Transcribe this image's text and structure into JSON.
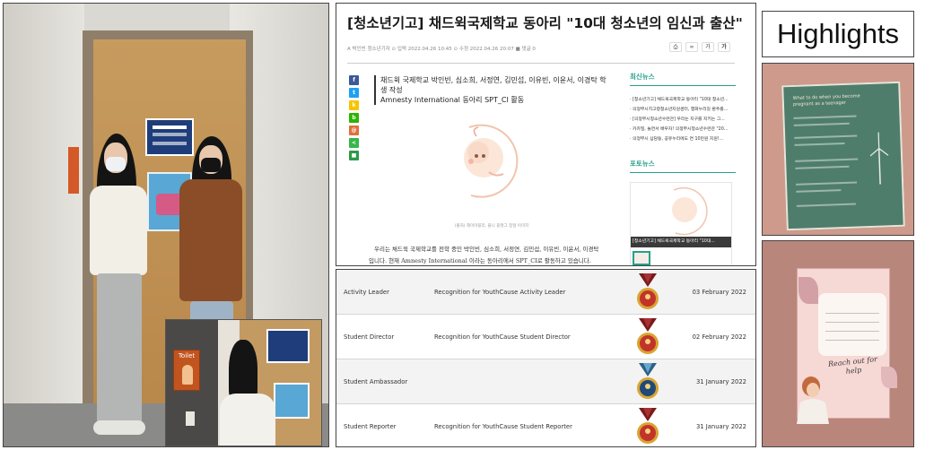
{
  "article": {
    "title": "[청소년기고] 채드윅국제학교 동아리 \"10대 청소년의 임신과 출산\"",
    "meta": "A 박인빈 청소년기자   ⊙ 입력 2022.04.26 10:45   ⊙ 수정 2022.04.26 20:07   ■ 댓글 0",
    "tools": [
      "⎙",
      "∞",
      "가",
      "가"
    ],
    "summary_line1": "채드윅 국제학교 박인빈, 심소희, 서정연, 김민섭, 이유빈, 이윤서, 이경탁 학생 작성",
    "summary_line2": "Amnesty International 동아리 SPT_CI 활동",
    "image_caption": "(출처) 헤이마블리, 풀니 플랫그 창형 이미지",
    "body": "우리는 채드윅 국제학교를 전학 중인 박인빈, 심소희, 서정연, 김민섭, 이유빈, 이윤서, 이경탁입니다. 현재 Amnesty International 이라는 동아리에서 SPT_CI로 활동하고 있습니다.",
    "share_icons": [
      {
        "glyph": "f",
        "color": "#3b5998"
      },
      {
        "glyph": "t",
        "color": "#1da1f2"
      },
      {
        "glyph": "k",
        "color": "#f7c400"
      },
      {
        "glyph": "b",
        "color": "#2db400"
      },
      {
        "glyph": "@",
        "color": "#e0703a"
      },
      {
        "glyph": "<",
        "color": "#39b54a"
      },
      {
        "glyph": "■",
        "color": "#2c9a4a"
      }
    ],
    "sidebar": {
      "latest_heading": "최신뉴스",
      "news": [
        "· [청소년기고] 채드윅국제학교 동아리 \"10대 청소년...",
        "· 의정부시치고령청소년지원센터, 행화누리길 환주를...",
        "· [의정부시청소년수련관] 우리는 지구를 지키는 그...",
        "· 카카밀, 놀면서 배우자! 의정부시청소년수련관 \"20...",
        "· 의정부시 삼담동, 공유누리에도 연 10만원 지원!..."
      ],
      "photo_heading": "포토뉴스",
      "photo_caption": "[청소년기고] 채드윅국제학교 동아리 \"10대..."
    }
  },
  "awards": [
    {
      "role": "Activity Leader",
      "description": "Recognition for YouthCause Activity Leader",
      "date": "03 February 2022",
      "medal": "red"
    },
    {
      "role": "Student Director",
      "description": "Recognition for YouthCause Student Director",
      "date": "02 February 2022",
      "medal": "red"
    },
    {
      "role": "Student Ambassador",
      "description": "",
      "date": "31 January 2022",
      "medal": "blue"
    },
    {
      "role": "Student Reporter",
      "description": "Recognition for YouthCause Student Reporter",
      "date": "31 January 2022",
      "medal": "red"
    }
  ],
  "highlights": {
    "title": "Highlights",
    "poster_text": "What to do when you become pregnant as a teenager",
    "card_text": "Reach out for help"
  },
  "inset": {
    "sign_text": "Toilet"
  }
}
